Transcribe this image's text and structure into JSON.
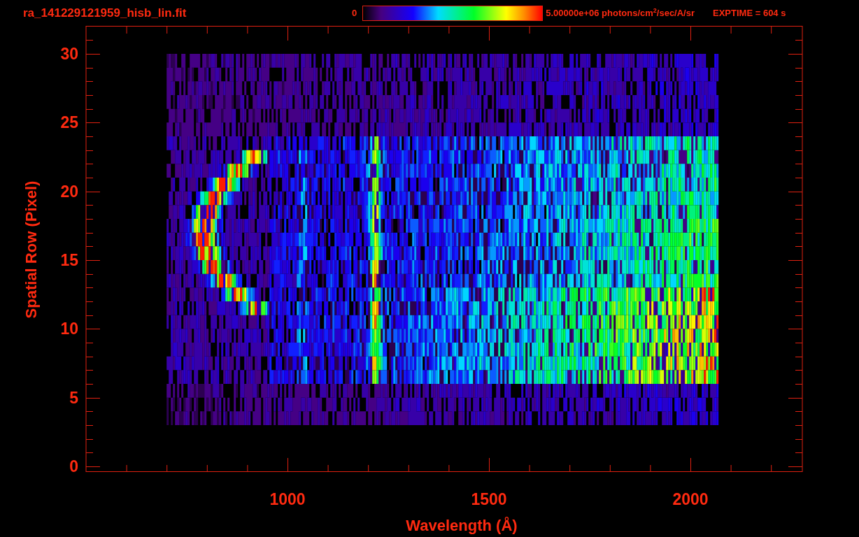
{
  "title": "ra_141229121959_hisb_lin.fit",
  "color_bar": {
    "min_label": "0",
    "max_label": "5.00000e+06 photons/cm$^{2}$/sec/A/sr"
  },
  "exposure": "EXPTIME = 604 s",
  "x_axis": {
    "title": "Wavelength (Å)",
    "ticks": [
      "1000",
      "1500",
      "2000"
    ]
  },
  "y_axis": {
    "title": "Spatial Row (Pixel)",
    "ticks": [
      "30",
      "25",
      "20",
      "15",
      "10",
      "5",
      "0"
    ]
  }
}
